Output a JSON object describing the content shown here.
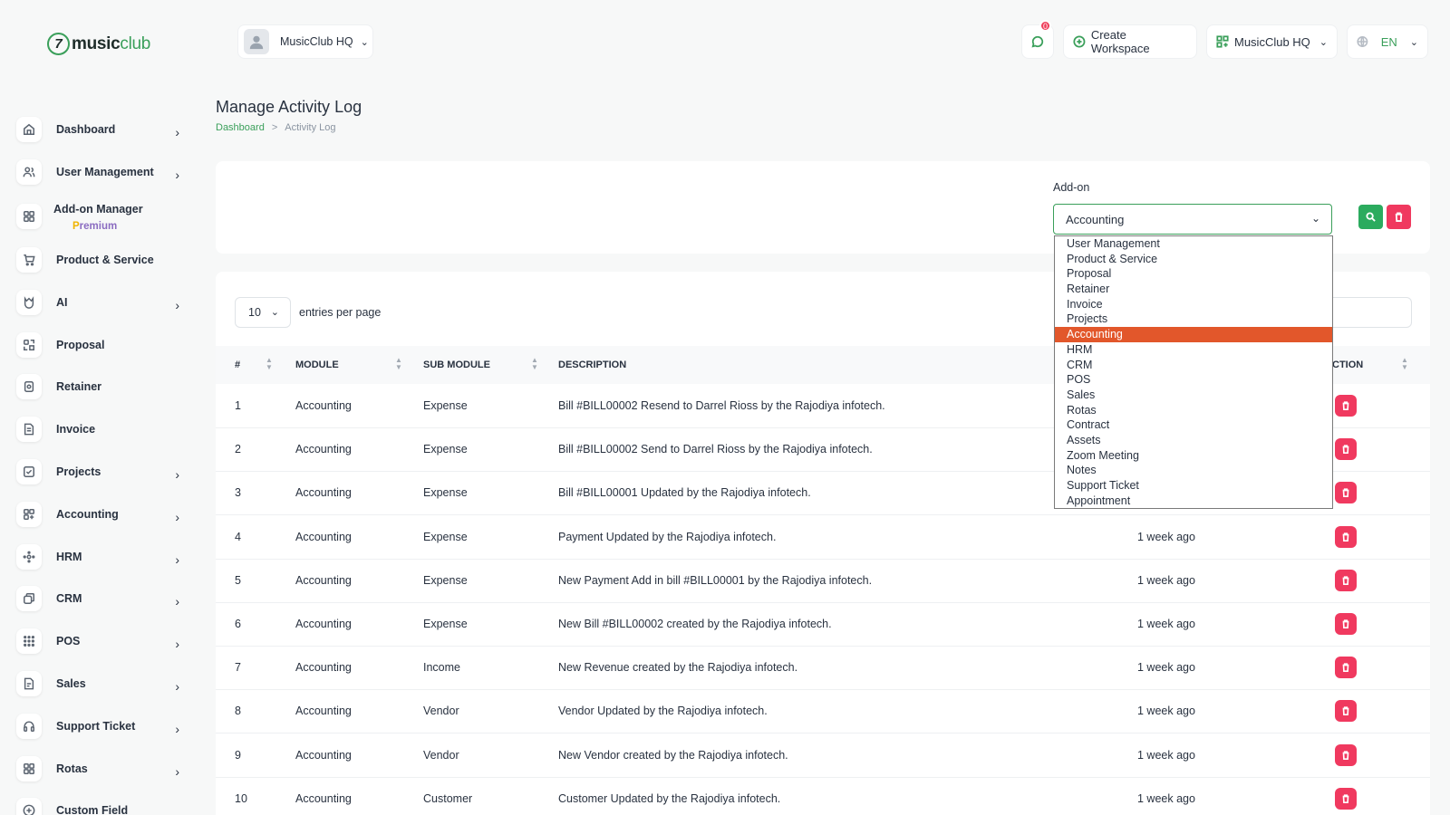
{
  "brand": {
    "logo_mark": "7",
    "name_bold": "music",
    "name_accent": "club"
  },
  "workspace_selector": {
    "label": "MusicClub HQ"
  },
  "header": {
    "notification_count": "0",
    "create_workspace": "Create Workspace",
    "workspace_switch": "MusicClub HQ",
    "language": "EN"
  },
  "sidebar": {
    "items": [
      {
        "label": "Dashboard",
        "icon": "home-icon",
        "chevron": true
      },
      {
        "label": "User Management",
        "icon": "users-icon",
        "chevron": true
      },
      {
        "label": "Add-on Manager",
        "sub_p": "P",
        "sub_rest": "remium",
        "icon": "grid-icon",
        "chevron": false
      },
      {
        "label": "Product & Service",
        "icon": "cart-icon",
        "chevron": false
      },
      {
        "label": "AI",
        "icon": "ai-icon",
        "chevron": true
      },
      {
        "label": "Proposal",
        "icon": "proposal-icon",
        "chevron": false
      },
      {
        "label": "Retainer",
        "icon": "retainer-icon",
        "chevron": false
      },
      {
        "label": "Invoice",
        "icon": "invoice-icon",
        "chevron": false
      },
      {
        "label": "Projects",
        "icon": "projects-icon",
        "chevron": true
      },
      {
        "label": "Accounting",
        "icon": "accounting-icon",
        "chevron": true
      },
      {
        "label": "HRM",
        "icon": "hrm-icon",
        "chevron": true
      },
      {
        "label": "CRM",
        "icon": "crm-icon",
        "chevron": true
      },
      {
        "label": "POS",
        "icon": "pos-icon",
        "chevron": true
      },
      {
        "label": "Sales",
        "icon": "sales-icon",
        "chevron": true
      },
      {
        "label": "Support Ticket",
        "icon": "headset-icon",
        "chevron": true
      },
      {
        "label": "Rotas",
        "icon": "rotas-icon",
        "chevron": true
      },
      {
        "label": "Custom Field",
        "icon": "plus-circle-icon",
        "chevron": false
      }
    ]
  },
  "page": {
    "title": "Manage Activity Log",
    "breadcrumb": {
      "home": "Dashboard",
      "separator": ">",
      "current": "Activity Log"
    }
  },
  "filter": {
    "label": "Add-on",
    "selected": "Accounting",
    "options": [
      "User Management",
      "Product & Service",
      "Proposal",
      "Retainer",
      "Invoice",
      "Projects",
      "Accounting",
      "HRM",
      "CRM",
      "POS",
      "Sales",
      "Rotas",
      "Contract",
      "Assets",
      "Zoom Meeting",
      "Notes",
      "Support Ticket",
      "Appointment"
    ],
    "active_index": 6
  },
  "table": {
    "per_page": "10",
    "per_page_label": "entries per page",
    "headers": [
      "#",
      "MODULE",
      "SUB MODULE",
      "DESCRIPTION",
      "CTION"
    ],
    "rows": [
      {
        "n": "1",
        "module": "Accounting",
        "sub": "Expense",
        "desc": "Bill #BILL00002 Resend to Darrel Rioss by the Rajodiya infotech.",
        "time": ""
      },
      {
        "n": "2",
        "module": "Accounting",
        "sub": "Expense",
        "desc": "Bill #BILL00002 Send to Darrel Rioss by the Rajodiya infotech.",
        "time": ""
      },
      {
        "n": "3",
        "module": "Accounting",
        "sub": "Expense",
        "desc": "Bill #BILL00001 Updated by the Rajodiya infotech.",
        "time": ""
      },
      {
        "n": "4",
        "module": "Accounting",
        "sub": "Expense",
        "desc": "Payment Updated by the Rajodiya infotech.",
        "time": "1 week ago"
      },
      {
        "n": "5",
        "module": "Accounting",
        "sub": "Expense",
        "desc": "New Payment Add in bill #BILL00001 by the Rajodiya infotech.",
        "time": "1 week ago"
      },
      {
        "n": "6",
        "module": "Accounting",
        "sub": "Expense",
        "desc": "New Bill #BILL00002 created by the Rajodiya infotech.",
        "time": "1 week ago"
      },
      {
        "n": "7",
        "module": "Accounting",
        "sub": "Income",
        "desc": "New Revenue created by the Rajodiya infotech.",
        "time": "1 week ago"
      },
      {
        "n": "8",
        "module": "Accounting",
        "sub": "Vendor",
        "desc": "Vendor Updated by the Rajodiya infotech.",
        "time": "1 week ago"
      },
      {
        "n": "9",
        "module": "Accounting",
        "sub": "Vendor",
        "desc": "New Vendor created by the Rajodiya infotech.",
        "time": "1 week ago"
      },
      {
        "n": "10",
        "module": "Accounting",
        "sub": "Customer",
        "desc": "Customer Updated by the Rajodiya infotech.",
        "time": "1 week ago"
      }
    ]
  },
  "colors": {
    "brand_green": "#3a9f5a",
    "danger": "#f0395f",
    "dropdown_highlight": "#e2572b"
  }
}
